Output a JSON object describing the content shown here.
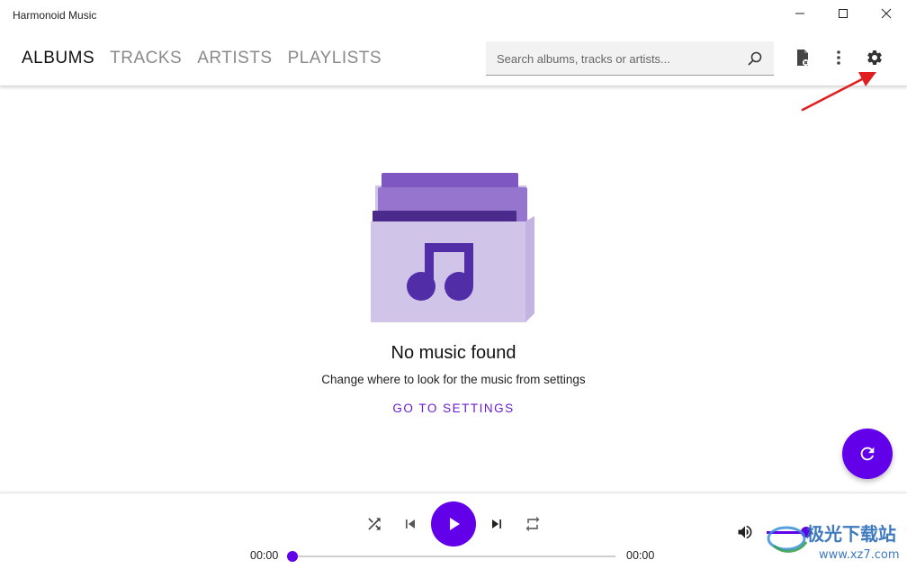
{
  "window": {
    "title": "Harmonoid Music"
  },
  "header": {
    "tabs": [
      {
        "label": "ALBUMS",
        "active": true
      },
      {
        "label": "TRACKS",
        "active": false
      },
      {
        "label": "ARTISTS",
        "active": false
      },
      {
        "label": "PLAYLISTS",
        "active": false
      }
    ],
    "search": {
      "placeholder": "Search albums, tracks or artists...",
      "value": ""
    },
    "icons": [
      "file-import-icon",
      "more-vertical-icon",
      "settings-gear-icon"
    ]
  },
  "empty_state": {
    "title": "No music found",
    "subtitle": "Change where to look for the music from settings",
    "action_label": "GO TO SETTINGS"
  },
  "player": {
    "position": "00:00",
    "duration": "00:00",
    "progress": 0,
    "volume": 1.0,
    "controls": [
      "shuffle-icon",
      "previous-icon",
      "play-icon",
      "next-icon",
      "repeat-icon"
    ]
  },
  "watermark": {
    "text": "极光下载站",
    "url": "www.xz7.com"
  },
  "colors": {
    "accent": "#6200ea",
    "link": "#6a1ccf",
    "annotation_arrow": "#e02020",
    "folder_light": "#d1c4e9",
    "folder_mid": "#9575cd",
    "folder_dark": "#4a2a8a"
  }
}
